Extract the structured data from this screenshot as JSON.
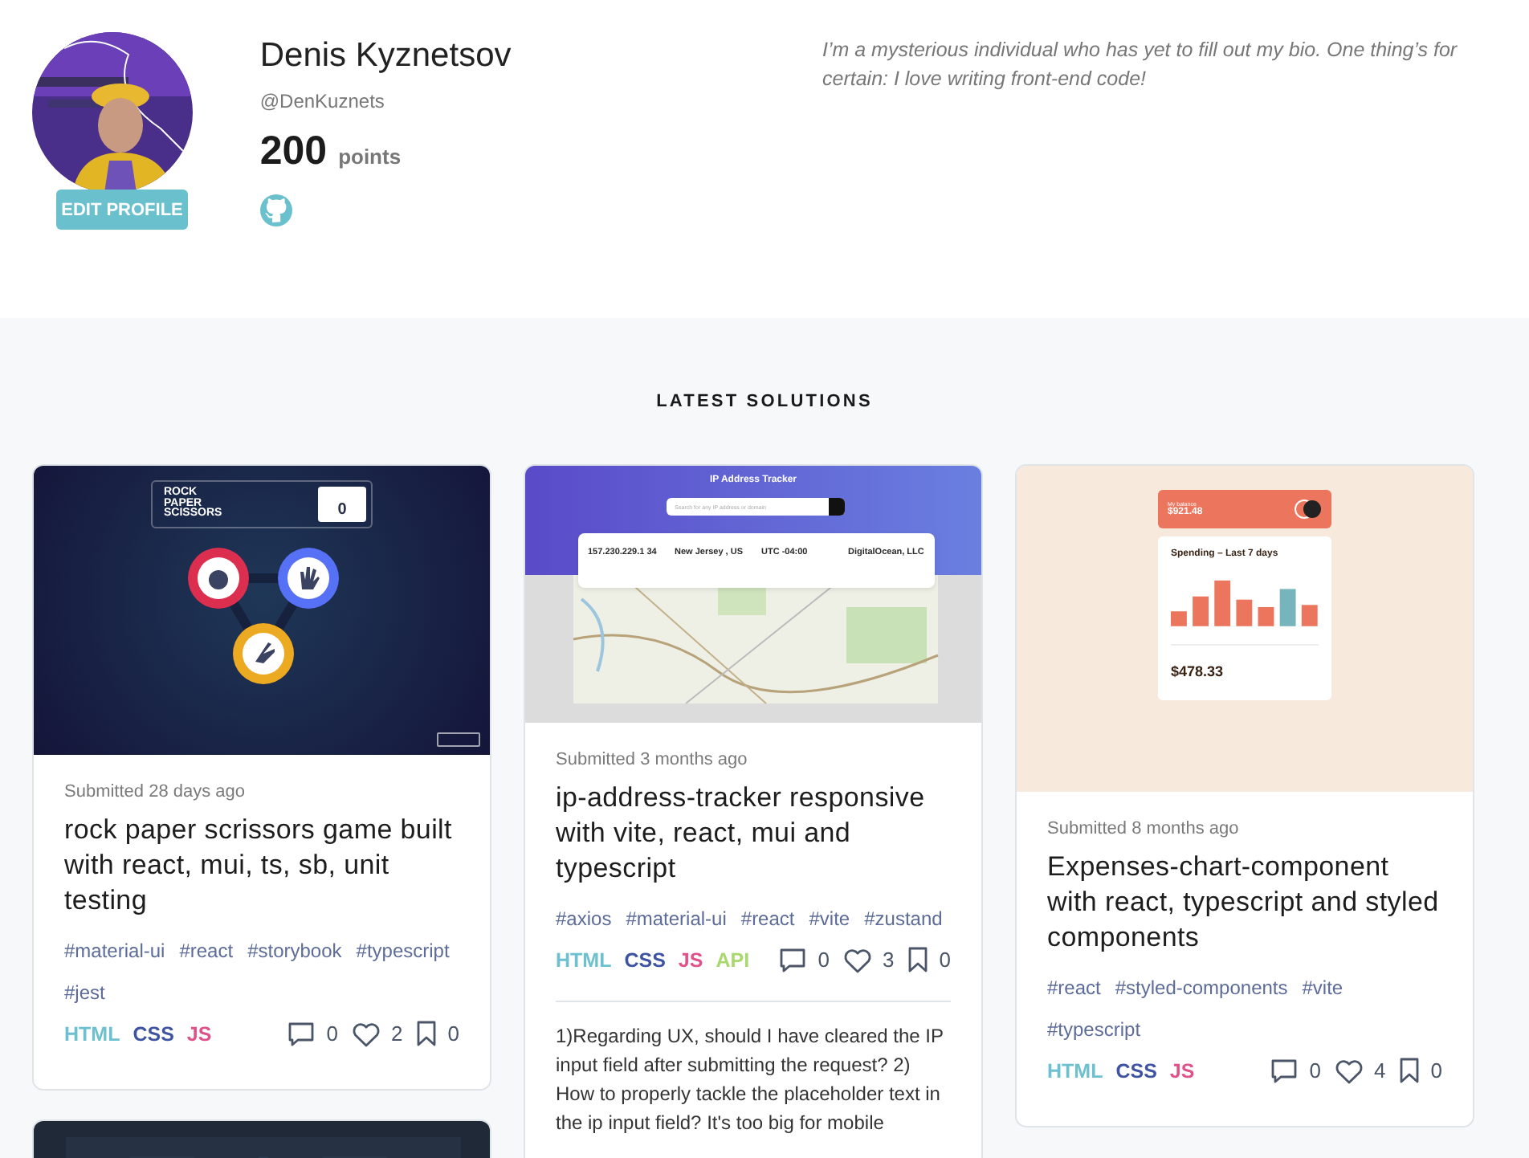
{
  "profile": {
    "name": "Denis Kyznetsov",
    "handle": "@DenKuznets",
    "points": "200",
    "points_label": "points",
    "edit_button": "EDIT PROFILE",
    "bio": "I’m a mysterious individual who has yet to fill out my bio. One thing’s for certain: I love writing front-end code!"
  },
  "section_title": "LATEST SOLUTIONS",
  "cards": [
    {
      "preview": {
        "kind": "game",
        "title": "ROCK PAPER SCISSORS",
        "score": "0"
      },
      "submitted": "Submitted 28 days ago",
      "title": "rock paper scrissors game built with react, mui, ts, sb, unit testing",
      "tags": [
        "#material-ui",
        "#react",
        "#storybook",
        "#typescript",
        "#jest"
      ],
      "languages": [
        {
          "label": "HTML",
          "color": "#6cc0d0"
        },
        {
          "label": "CSS",
          "color": "#3e54a3"
        },
        {
          "label": "JS",
          "color": "#e0508a"
        }
      ],
      "stats": [
        {
          "kind": "comments",
          "count": "0"
        },
        {
          "kind": "likes",
          "count": "2"
        },
        {
          "kind": "bookmarks",
          "count": "0"
        }
      ]
    },
    {
      "preview": {
        "kind": "tracker",
        "title": "IP Address Tracker",
        "placeholder": "Search for any IP address or domain",
        "values": [
          "157.230.229.1 34",
          "New Jersey , US",
          "UTC -04:00",
          "DigitalOcean, LLC"
        ]
      },
      "submitted": "Submitted 3 months ago",
      "title": "ip-address-tracker responsive with vite, react, mui and typescript",
      "tags": [
        "#axios",
        "#material-ui",
        "#react",
        "#vite",
        "#zustand"
      ],
      "languages": [
        {
          "label": "HTML",
          "color": "#6cc0d0"
        },
        {
          "label": "CSS",
          "color": "#3e54a3"
        },
        {
          "label": "JS",
          "color": "#e0508a"
        },
        {
          "label": "API",
          "color": "#a9d86e"
        }
      ],
      "stats": [
        {
          "kind": "comments",
          "count": "0"
        },
        {
          "kind": "likes",
          "count": "3"
        },
        {
          "kind": "bookmarks",
          "count": "0"
        }
      ],
      "feedback": "1)Regarding UX, should I have cleared the IP input field after submitting the request? 2) How to properly tackle the placeholder text in the ip input field? It's too big for mobile"
    },
    {
      "preview": {
        "kind": "expenses",
        "balance_label": "My balance",
        "balance": "$921.48",
        "chart_title": "Spending – Last 7 days",
        "total": "$478.33"
      },
      "submitted": "Submitted 8 months ago",
      "title": "Expenses-chart-component with react, typescript and styled components",
      "tags": [
        "#react",
        "#styled-components",
        "#vite",
        "#typescript"
      ],
      "languages": [
        {
          "label": "HTML",
          "color": "#6cc0d0"
        },
        {
          "label": "CSS",
          "color": "#3e54a3"
        },
        {
          "label": "JS",
          "color": "#e0508a"
        }
      ],
      "stats": [
        {
          "kind": "comments",
          "count": "0"
        },
        {
          "kind": "likes",
          "count": "4"
        },
        {
          "kind": "bookmarks",
          "count": "0"
        }
      ]
    },
    {
      "preview": {
        "kind": "picture"
      }
    }
  ]
}
